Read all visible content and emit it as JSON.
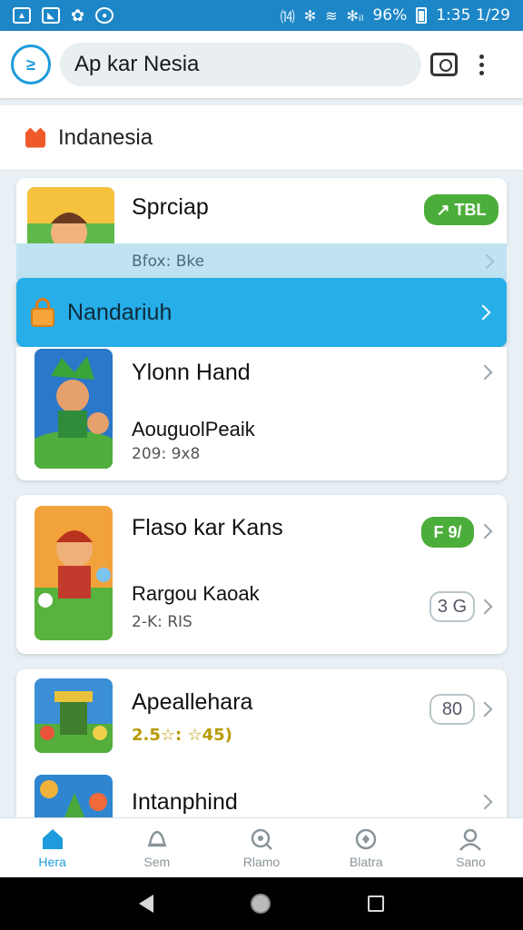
{
  "status_bar": {
    "left_icons": [
      "image-icon",
      "gallery-icon",
      "game-icon",
      "chat-icon"
    ],
    "right_text": "1⅓ ✻ ≋ ✻ᵢₗ 96% ▮ 1:35 1/29",
    "battery": "96%",
    "time": "1:35 1/29"
  },
  "search": {
    "logo_text": "≥",
    "query": "Ap kar Nesia"
  },
  "region": {
    "label": "Indanesia"
  },
  "cards": [
    {
      "title": "Sprciap",
      "badge": "↗ TBL",
      "meta": "Bfox: Bke"
    },
    {
      "title": "Ylonn Hand",
      "subtitle": "AouguolPeaik",
      "meta": "209: 9x8"
    },
    {
      "title": "Flaso kar Kans",
      "badge": "F 9/",
      "subtitle": "Rargou Kaoak",
      "meta": "2-K:  RIS",
      "outline_badge": "3 G"
    },
    {
      "title": "Apeallehara",
      "rating": "2.5☆: ☆45)",
      "outline_badge": "80"
    },
    {
      "title": "Intanphind"
    }
  ],
  "banner": {
    "label": "Nandariuh"
  },
  "bottom_nav": [
    {
      "label": "Hera",
      "icon": "home-icon",
      "active": true
    },
    {
      "label": "Sem",
      "icon": "bell-icon",
      "active": false
    },
    {
      "label": "Rlamo",
      "icon": "search-icon",
      "active": false
    },
    {
      "label": "Blatra",
      "icon": "badge-icon",
      "active": false
    },
    {
      "label": "Sano",
      "icon": "profile-icon",
      "active": false
    }
  ],
  "colors": {
    "status_bar": "#1c86c7",
    "accent": "#1d9bdc",
    "banner": "#27aee8",
    "green_badge": "#4cae3a"
  }
}
